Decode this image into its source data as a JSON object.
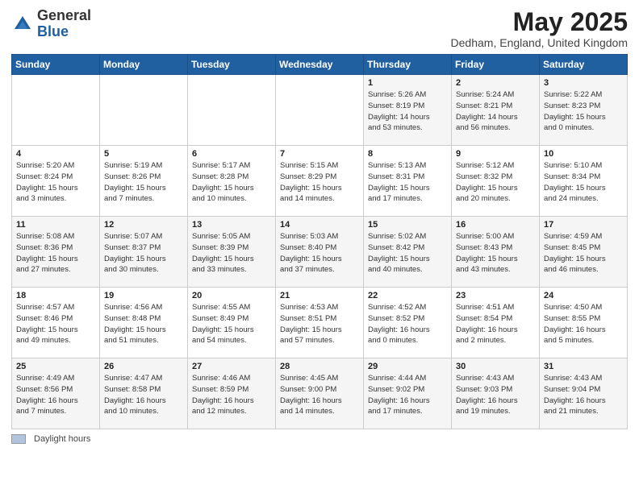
{
  "header": {
    "logo_general": "General",
    "logo_blue": "Blue",
    "month_title": "May 2025",
    "location": "Dedham, England, United Kingdom"
  },
  "footer": {
    "legend_label": "Daylight hours"
  },
  "weekdays": [
    "Sunday",
    "Monday",
    "Tuesday",
    "Wednesday",
    "Thursday",
    "Friday",
    "Saturday"
  ],
  "weeks": [
    [
      {
        "day": "",
        "info": ""
      },
      {
        "day": "",
        "info": ""
      },
      {
        "day": "",
        "info": ""
      },
      {
        "day": "",
        "info": ""
      },
      {
        "day": "1",
        "info": "Sunrise: 5:26 AM\nSunset: 8:19 PM\nDaylight: 14 hours\nand 53 minutes."
      },
      {
        "day": "2",
        "info": "Sunrise: 5:24 AM\nSunset: 8:21 PM\nDaylight: 14 hours\nand 56 minutes."
      },
      {
        "day": "3",
        "info": "Sunrise: 5:22 AM\nSunset: 8:23 PM\nDaylight: 15 hours\nand 0 minutes."
      }
    ],
    [
      {
        "day": "4",
        "info": "Sunrise: 5:20 AM\nSunset: 8:24 PM\nDaylight: 15 hours\nand 3 minutes."
      },
      {
        "day": "5",
        "info": "Sunrise: 5:19 AM\nSunset: 8:26 PM\nDaylight: 15 hours\nand 7 minutes."
      },
      {
        "day": "6",
        "info": "Sunrise: 5:17 AM\nSunset: 8:28 PM\nDaylight: 15 hours\nand 10 minutes."
      },
      {
        "day": "7",
        "info": "Sunrise: 5:15 AM\nSunset: 8:29 PM\nDaylight: 15 hours\nand 14 minutes."
      },
      {
        "day": "8",
        "info": "Sunrise: 5:13 AM\nSunset: 8:31 PM\nDaylight: 15 hours\nand 17 minutes."
      },
      {
        "day": "9",
        "info": "Sunrise: 5:12 AM\nSunset: 8:32 PM\nDaylight: 15 hours\nand 20 minutes."
      },
      {
        "day": "10",
        "info": "Sunrise: 5:10 AM\nSunset: 8:34 PM\nDaylight: 15 hours\nand 24 minutes."
      }
    ],
    [
      {
        "day": "11",
        "info": "Sunrise: 5:08 AM\nSunset: 8:36 PM\nDaylight: 15 hours\nand 27 minutes."
      },
      {
        "day": "12",
        "info": "Sunrise: 5:07 AM\nSunset: 8:37 PM\nDaylight: 15 hours\nand 30 minutes."
      },
      {
        "day": "13",
        "info": "Sunrise: 5:05 AM\nSunset: 8:39 PM\nDaylight: 15 hours\nand 33 minutes."
      },
      {
        "day": "14",
        "info": "Sunrise: 5:03 AM\nSunset: 8:40 PM\nDaylight: 15 hours\nand 37 minutes."
      },
      {
        "day": "15",
        "info": "Sunrise: 5:02 AM\nSunset: 8:42 PM\nDaylight: 15 hours\nand 40 minutes."
      },
      {
        "day": "16",
        "info": "Sunrise: 5:00 AM\nSunset: 8:43 PM\nDaylight: 15 hours\nand 43 minutes."
      },
      {
        "day": "17",
        "info": "Sunrise: 4:59 AM\nSunset: 8:45 PM\nDaylight: 15 hours\nand 46 minutes."
      }
    ],
    [
      {
        "day": "18",
        "info": "Sunrise: 4:57 AM\nSunset: 8:46 PM\nDaylight: 15 hours\nand 49 minutes."
      },
      {
        "day": "19",
        "info": "Sunrise: 4:56 AM\nSunset: 8:48 PM\nDaylight: 15 hours\nand 51 minutes."
      },
      {
        "day": "20",
        "info": "Sunrise: 4:55 AM\nSunset: 8:49 PM\nDaylight: 15 hours\nand 54 minutes."
      },
      {
        "day": "21",
        "info": "Sunrise: 4:53 AM\nSunset: 8:51 PM\nDaylight: 15 hours\nand 57 minutes."
      },
      {
        "day": "22",
        "info": "Sunrise: 4:52 AM\nSunset: 8:52 PM\nDaylight: 16 hours\nand 0 minutes."
      },
      {
        "day": "23",
        "info": "Sunrise: 4:51 AM\nSunset: 8:54 PM\nDaylight: 16 hours\nand 2 minutes."
      },
      {
        "day": "24",
        "info": "Sunrise: 4:50 AM\nSunset: 8:55 PM\nDaylight: 16 hours\nand 5 minutes."
      }
    ],
    [
      {
        "day": "25",
        "info": "Sunrise: 4:49 AM\nSunset: 8:56 PM\nDaylight: 16 hours\nand 7 minutes."
      },
      {
        "day": "26",
        "info": "Sunrise: 4:47 AM\nSunset: 8:58 PM\nDaylight: 16 hours\nand 10 minutes."
      },
      {
        "day": "27",
        "info": "Sunrise: 4:46 AM\nSunset: 8:59 PM\nDaylight: 16 hours\nand 12 minutes."
      },
      {
        "day": "28",
        "info": "Sunrise: 4:45 AM\nSunset: 9:00 PM\nDaylight: 16 hours\nand 14 minutes."
      },
      {
        "day": "29",
        "info": "Sunrise: 4:44 AM\nSunset: 9:02 PM\nDaylight: 16 hours\nand 17 minutes."
      },
      {
        "day": "30",
        "info": "Sunrise: 4:43 AM\nSunset: 9:03 PM\nDaylight: 16 hours\nand 19 minutes."
      },
      {
        "day": "31",
        "info": "Sunrise: 4:43 AM\nSunset: 9:04 PM\nDaylight: 16 hours\nand 21 minutes."
      }
    ]
  ]
}
